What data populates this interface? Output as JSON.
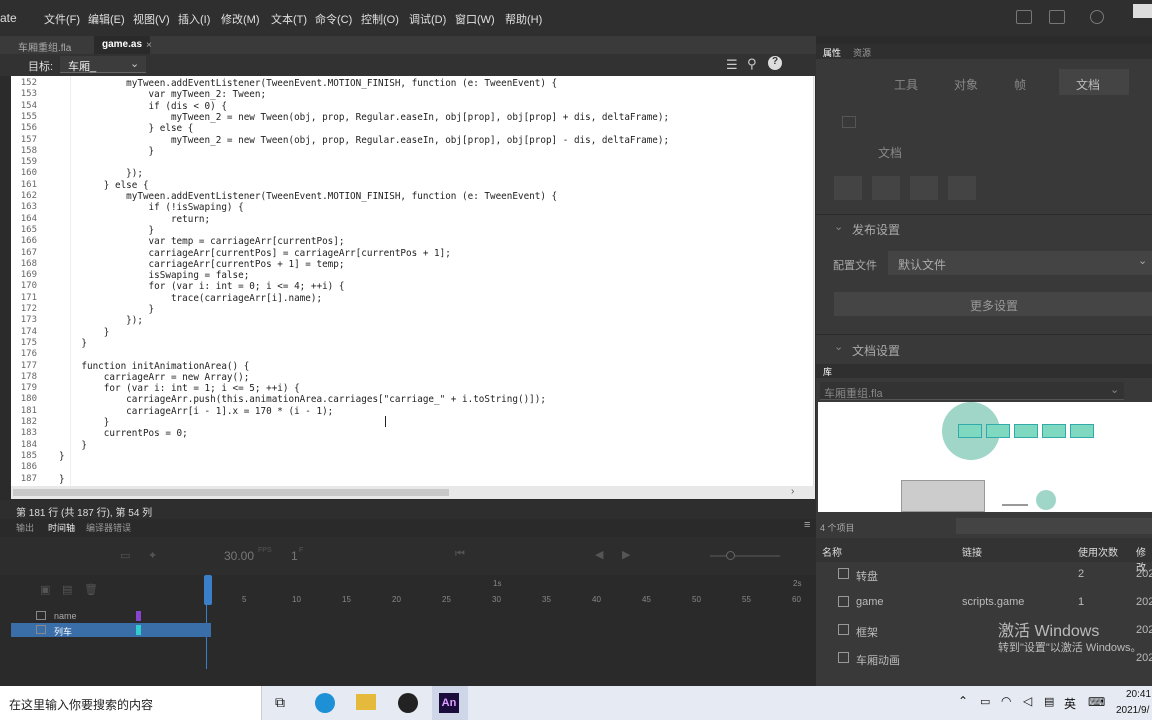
{
  "app": {
    "name_fragment": "ate"
  },
  "menu": [
    "文件(F)",
    "编辑(E)",
    "视图(V)",
    "插入(I)",
    "修改(M)",
    "文本(T)",
    "命令(C)",
    "控制(O)",
    "调试(D)",
    "窗口(W)",
    "帮助(H)"
  ],
  "tabs": [
    "车厢重组.fla",
    "game.as"
  ],
  "target": {
    "label": "目标:",
    "value": "车厢_"
  },
  "code": [
    {
      "n": "152",
      "t": "            myTween.addEventListener(TweenEvent.MOTION_FINISH, function (e: TweenEvent) {"
    },
    {
      "n": "153",
      "t": "                var myTween_2: Tween;"
    },
    {
      "n": "154",
      "t": "                if (dis < 0) {"
    },
    {
      "n": "155",
      "t": "                    myTween_2 = new Tween(obj, prop, Regular.easeIn, obj[prop], obj[prop] + dis, deltaFrame);"
    },
    {
      "n": "156",
      "t": "                } else {"
    },
    {
      "n": "157",
      "t": "                    myTween_2 = new Tween(obj, prop, Regular.easeIn, obj[prop], obj[prop] - dis, deltaFrame);"
    },
    {
      "n": "158",
      "t": "                }"
    },
    {
      "n": "159",
      "t": ""
    },
    {
      "n": "160",
      "t": "            });"
    },
    {
      "n": "161",
      "t": "        } else {"
    },
    {
      "n": "162",
      "t": "            myTween.addEventListener(TweenEvent.MOTION_FINISH, function (e: TweenEvent) {"
    },
    {
      "n": "163",
      "t": "                if (!isSwaping) {"
    },
    {
      "n": "164",
      "t": "                    return;"
    },
    {
      "n": "165",
      "t": "                }"
    },
    {
      "n": "166",
      "t": "                var temp = carriageArr[currentPos];"
    },
    {
      "n": "167",
      "t": "                carriageArr[currentPos] = carriageArr[currentPos + 1];"
    },
    {
      "n": "168",
      "t": "                carriageArr[currentPos + 1] = temp;"
    },
    {
      "n": "169",
      "t": "                isSwaping = false;"
    },
    {
      "n": "170",
      "t": "                for (var i: int = 0; i <= 4; ++i) {"
    },
    {
      "n": "171",
      "t": "                    trace(carriageArr[i].name);"
    },
    {
      "n": "172",
      "t": "                }"
    },
    {
      "n": "173",
      "t": "            });"
    },
    {
      "n": "174",
      "t": "        }"
    },
    {
      "n": "175",
      "t": "    }"
    },
    {
      "n": "176",
      "t": ""
    },
    {
      "n": "177",
      "t": "    function initAnimationArea() {"
    },
    {
      "n": "178",
      "t": "        carriageArr = new Array();"
    },
    {
      "n": "179",
      "t": "        for (var i: int = 1; i <= 5; ++i) {"
    },
    {
      "n": "180",
      "t": "            carriageArr.push(this.animationArea.carriages[\"carriage_\" + i.toString()]);"
    },
    {
      "n": "181",
      "t": "            carriageArr[i - 1].x = 170 * (i - 1);"
    },
    {
      "n": "182",
      "t": "        }"
    },
    {
      "n": "183",
      "t": "        currentPos = 0;"
    },
    {
      "n": "184",
      "t": "    }"
    },
    {
      "n": "185",
      "t": "}"
    },
    {
      "n": "186",
      "t": ""
    },
    {
      "n": "187",
      "t": "}"
    }
  ],
  "status": "第 181 行 (共 187 行), 第 54 列",
  "timeline": {
    "tabs": [
      "输出",
      "时间轴",
      "编译器错误"
    ],
    "fps": "30.00",
    "fps_unit": "FPS",
    "frame": "1",
    "frame_unit": "F",
    "ruler_top": "1s",
    "ruler_right": "2s",
    "ruler": [
      "5",
      "10",
      "15",
      "20",
      "25",
      "30",
      "35",
      "40",
      "45",
      "50",
      "55",
      "60"
    ],
    "layers": [
      {
        "name": "name",
        "color": "#8844cc",
        "selected": false
      },
      {
        "name": "列车",
        "color": "#33cccc",
        "selected": true
      }
    ]
  },
  "props": {
    "tabs": [
      "属性",
      "资源"
    ],
    "subtabs": [
      "工具",
      "对象",
      "帧",
      "文档"
    ],
    "doc_label": "文档",
    "publish": "发布设置",
    "profile_label": "配置文件",
    "profile_value": "默认文件",
    "more": "更多设置",
    "docsettings": "文档设置"
  },
  "library": {
    "title": "库",
    "file": "车厢重组.fla",
    "count": "4 个项目",
    "columns": [
      "名称",
      "链接",
      "使用次数",
      "修改"
    ],
    "items": [
      {
        "name": "转盘",
        "link": "",
        "uses": "2",
        "date": "202"
      },
      {
        "name": "game",
        "link": "scripts.game",
        "uses": "1",
        "date": "202"
      },
      {
        "name": "框架",
        "link": "",
        "uses": "",
        "date": "202"
      },
      {
        "name": "车厢动画",
        "link": "",
        "uses": "",
        "date": "202"
      }
    ]
  },
  "watermark": {
    "line1": "激活 Windows",
    "line2": "转到\"设置\"以激活 Windows。"
  },
  "taskbar": {
    "search": "在这里输入你要搜索的内容",
    "ime": "英",
    "time": "20:41",
    "date": "2021/9/"
  }
}
